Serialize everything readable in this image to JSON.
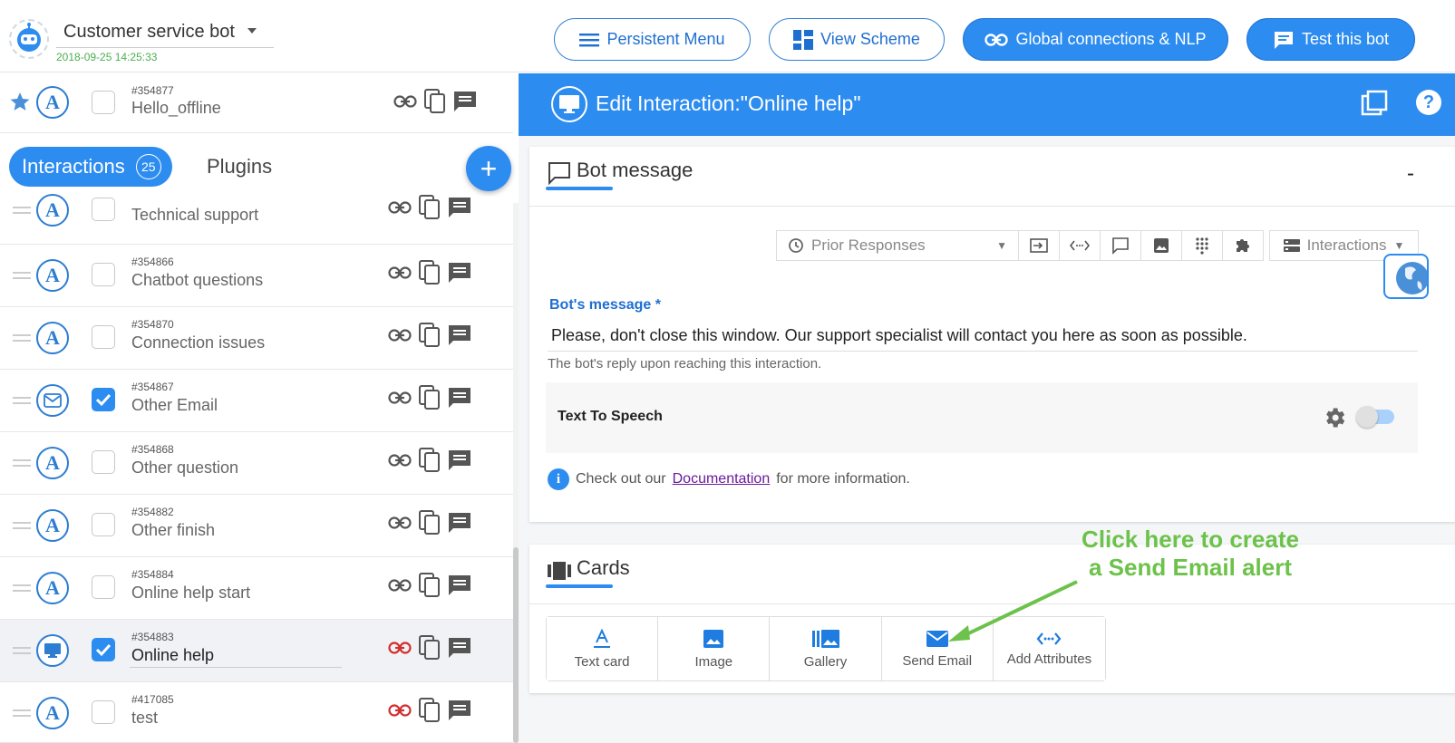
{
  "header": {
    "bot_name": "Customer service bot",
    "bot_date": "2018-09-25 14:25:33",
    "buttons": {
      "persistent_menu": "Persistent Menu",
      "view_scheme": "View Scheme",
      "global_connections": "Global connections & NLP",
      "test_bot": "Test this bot"
    }
  },
  "pinned": {
    "id": "#354877",
    "name": "Hello_offline"
  },
  "tabs": {
    "interactions": "Interactions",
    "interactions_count": "25",
    "plugins": "Plugins"
  },
  "list": [
    {
      "id": "",
      "name": "Technical support",
      "icon": "a-icon",
      "checked": false
    },
    {
      "id": "#354866",
      "name": "Chatbot questions",
      "icon": "a-icon",
      "checked": false
    },
    {
      "id": "#354870",
      "name": "Connection issues",
      "icon": "a-icon",
      "checked": false
    },
    {
      "id": "#354867",
      "name": "Other Email",
      "icon": "mail-icon",
      "checked": true
    },
    {
      "id": "#354868",
      "name": "Other question",
      "icon": "a-icon",
      "checked": false
    },
    {
      "id": "#354882",
      "name": "Other finish",
      "icon": "a-icon",
      "checked": false
    },
    {
      "id": "#354884",
      "name": "Online help start",
      "icon": "a-icon",
      "checked": false
    },
    {
      "id": "#354883",
      "name": "Online help",
      "icon": "monitor-icon",
      "checked": true,
      "selected": true
    },
    {
      "id": "#417085",
      "name": "test",
      "icon": "a-icon",
      "checked": false
    }
  ],
  "editor": {
    "title": "Edit Interaction:\"Online help\"",
    "bot_message_title": "Bot message",
    "collapse": "-",
    "prior_responses": "Prior Responses",
    "interactions_dropdown": "Interactions",
    "bots_message_label": "Bot's message *",
    "message": "Please, don't close this window. Our support specialist will contact you here as soon as possible.",
    "message_hint": "The bot's reply upon reaching this interaction.",
    "tts_label": "Text To Speech",
    "doc_prefix": "Check out our",
    "doc_link": "Documentation",
    "doc_suffix": "for more information."
  },
  "cards": {
    "title": "Cards",
    "buttons": [
      "Text card",
      "Image",
      "Gallery",
      "Send Email",
      "Add Attributes"
    ]
  },
  "callout": {
    "line1": "Click here to create",
    "line2": "a Send Email alert"
  },
  "colors": {
    "accent": "#2d8cf0",
    "callout": "#6cc24a",
    "link_red": "#d32f2f"
  }
}
